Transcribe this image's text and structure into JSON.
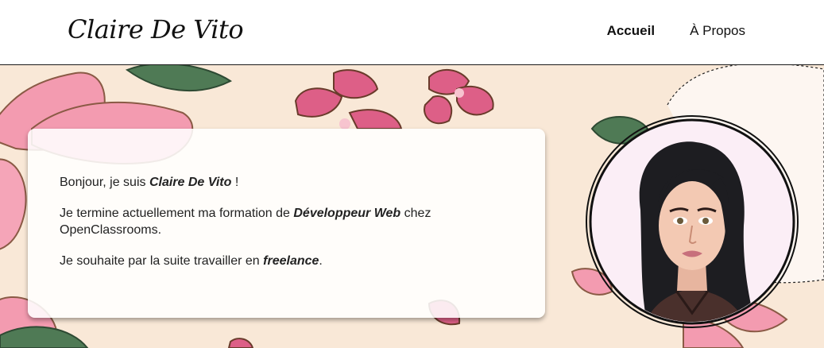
{
  "header": {
    "brand": "Claire De Vito",
    "nav": [
      {
        "label": "Accueil",
        "active": true
      },
      {
        "label": "À Propos",
        "active": false
      }
    ]
  },
  "intro": {
    "line1_prefix": "Bonjour, je suis ",
    "line1_name": "Claire De Vito",
    "line1_suffix": " !",
    "line2_prefix": "Je termine actuellement ma formation de ",
    "line2_emphasis": "Développeur Web",
    "line2_suffix": " chez OpenClassrooms.",
    "line3_prefix": "Je souhaite par la suite travailler en ",
    "line3_emphasis": "freelance",
    "line3_suffix": "."
  },
  "colors": {
    "background": "#f9e8d7",
    "petal_pink": "#f39bb0",
    "petal_dark_pink": "#dd5f87",
    "leaf_green": "#4f7a55",
    "outline": "#7a4b3a"
  },
  "avatar": {
    "icon": "portrait-illustration"
  }
}
